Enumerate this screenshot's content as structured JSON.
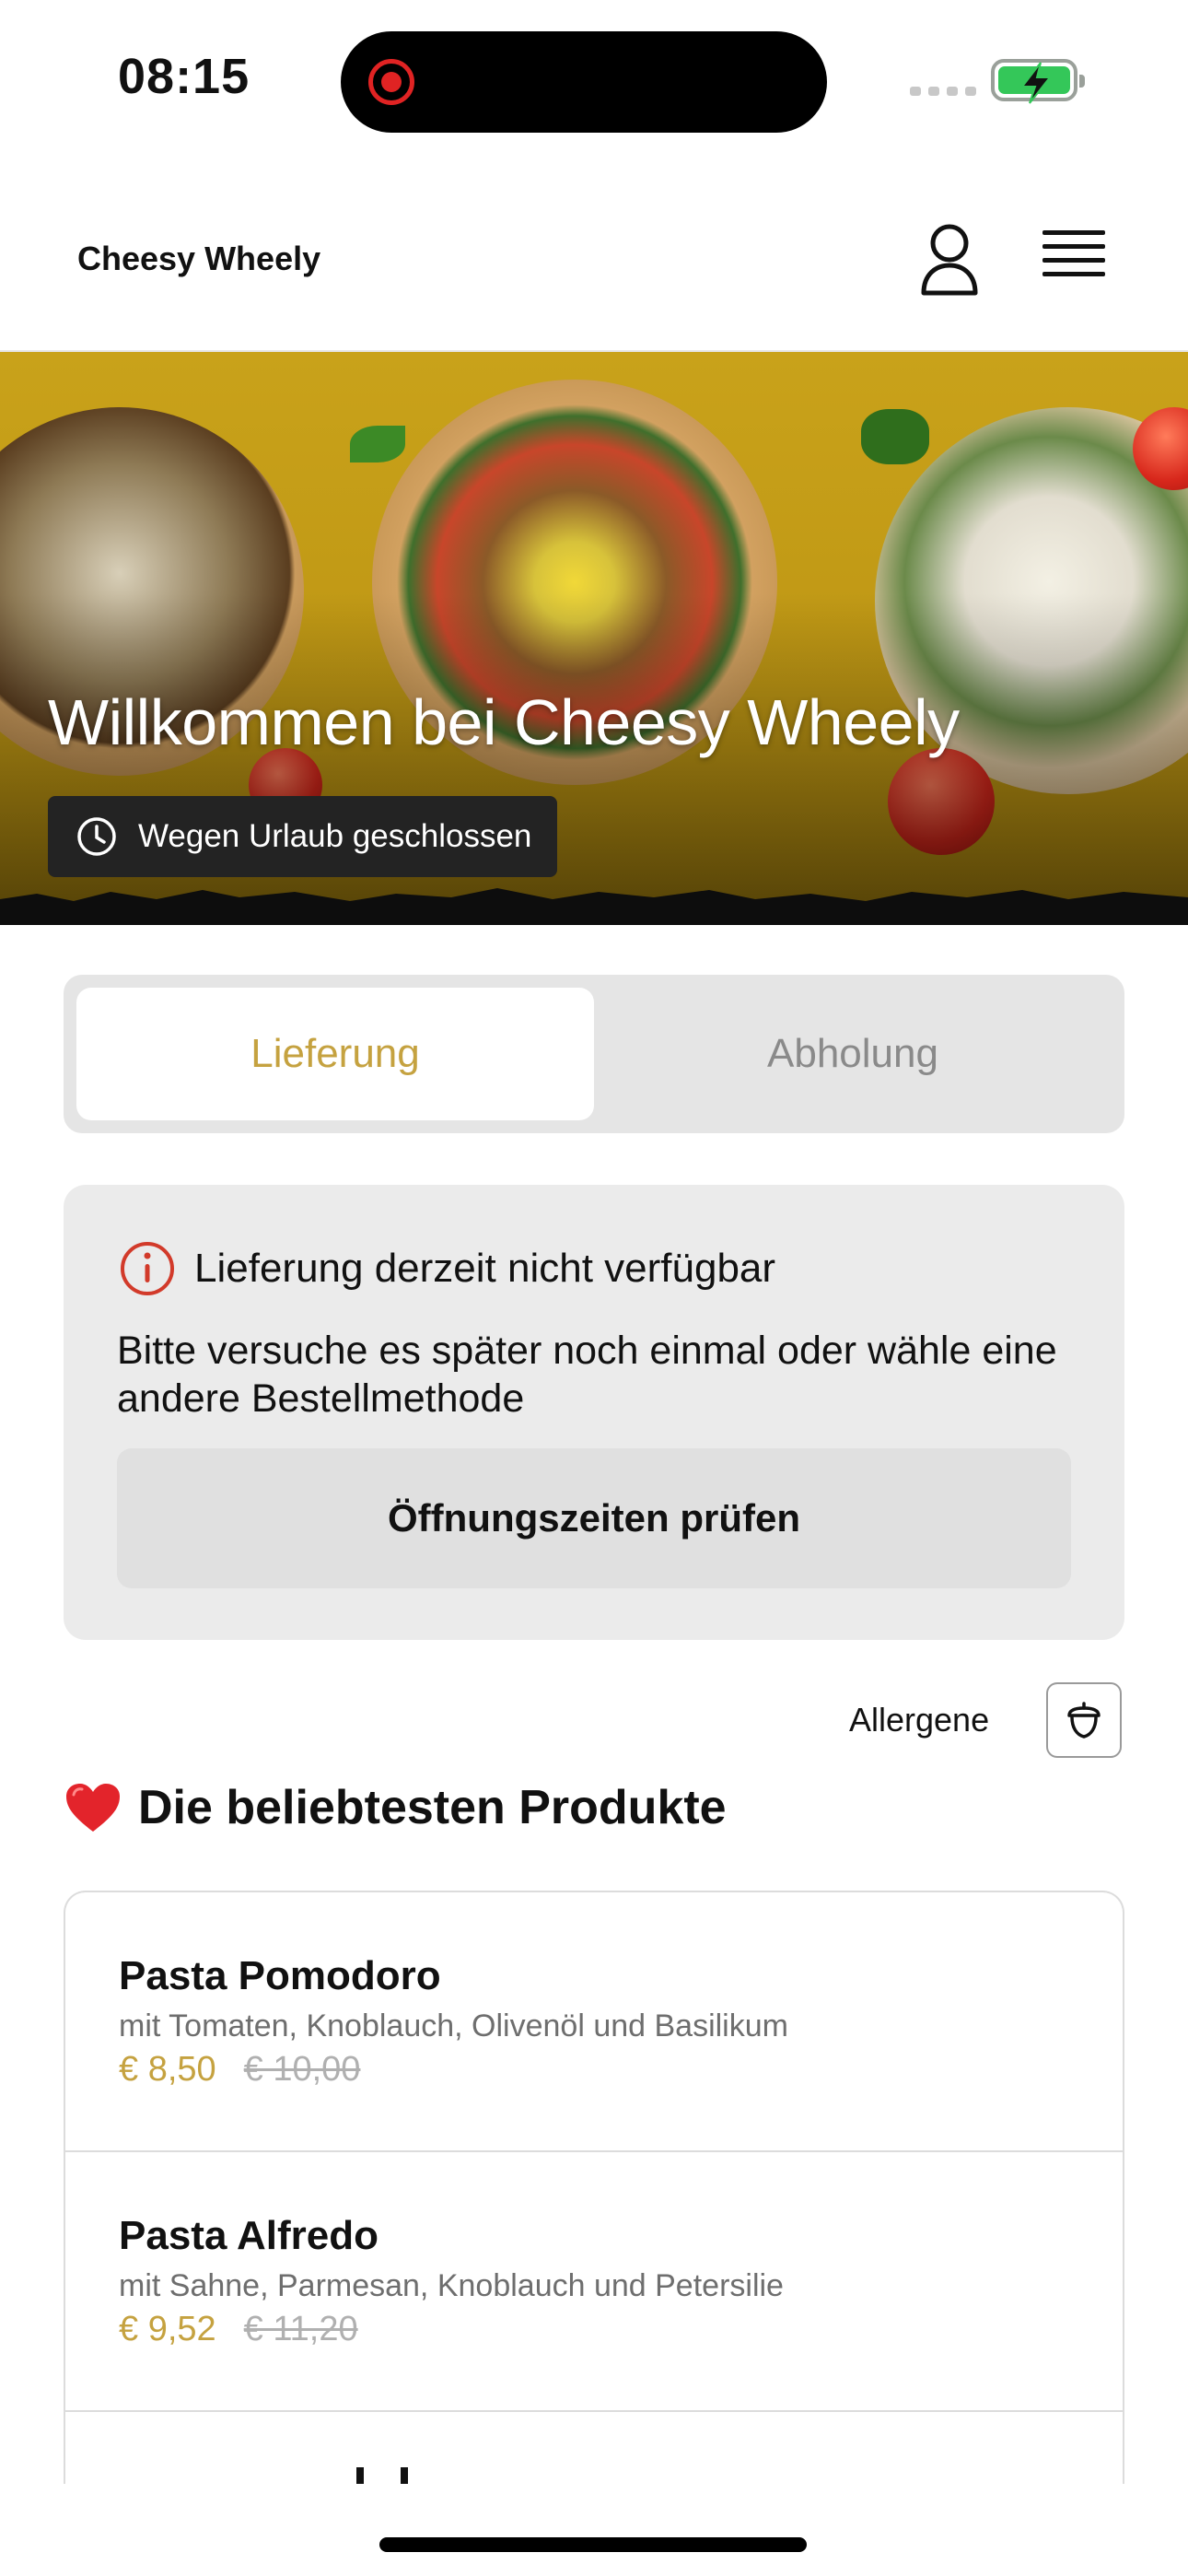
{
  "status_bar": {
    "time": "08:15"
  },
  "header": {
    "brand": "Cheesy Wheely",
    "icons": [
      "user-icon",
      "hamburger-menu-icon"
    ]
  },
  "hero": {
    "title": "Willkommen bei Cheesy Wheely",
    "status": "Wegen Urlaub geschlossen",
    "accent_color": "#c9a21a"
  },
  "tabs": [
    {
      "label": "Lieferung",
      "active": true
    },
    {
      "label": "Abholung",
      "active": false
    }
  ],
  "notice": {
    "title": "Lieferung derzeit nicht verfügbar",
    "text": "Bitte versuche es später noch einmal oder wähle eine andere Bestellmethode",
    "button": "Öffnungszeiten prüfen",
    "icon": "info-circle-icon",
    "icon_color": "#d23a2a"
  },
  "allergens": {
    "label": "Allergene",
    "icon": "acorn-icon"
  },
  "section": {
    "emoji": "❤️",
    "title": "Die beliebtesten Produkte"
  },
  "products": [
    {
      "name": "Pasta Pomodoro",
      "description": "mit Tomaten, Knoblauch, Olivenöl und Basilikum",
      "price": "€ 8,50",
      "old_price": "€ 10,00"
    },
    {
      "name": "Pasta Alfredo",
      "description": "mit Sahne, Parmesan, Knoblauch und Petersilie",
      "price": "€ 9,52",
      "old_price": "€ 11,20"
    }
  ],
  "colors": {
    "price": "#c5a240",
    "old_price": "#b0b0b0",
    "active_tab_text": "#c5a240"
  }
}
